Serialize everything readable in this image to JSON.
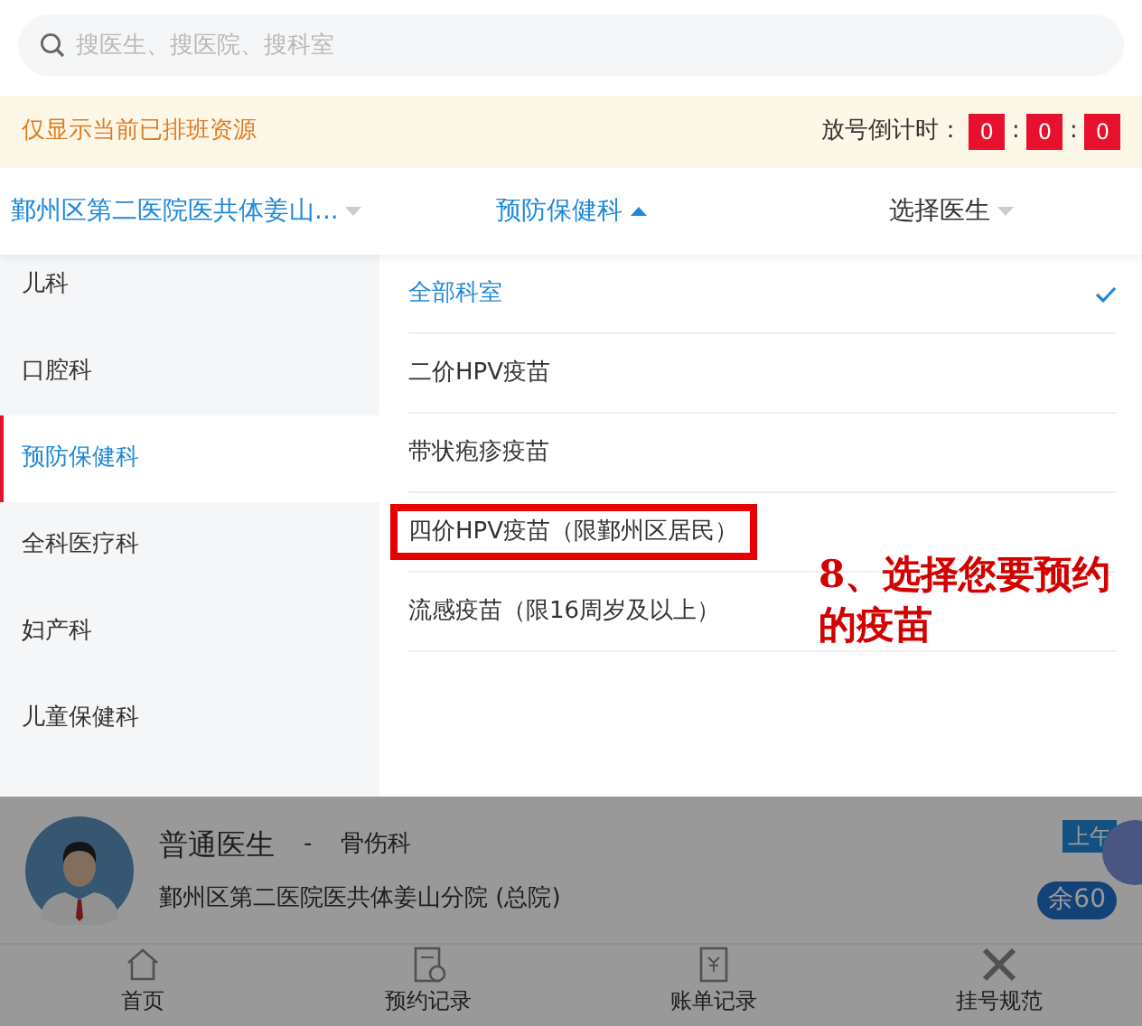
{
  "search": {
    "placeholder": "搜医生、搜医院、搜科室"
  },
  "notice": {
    "text": "仅显示当前已排班资源",
    "countdown_label": "放号倒计时：",
    "countdown": [
      "0",
      "0",
      "0"
    ],
    "separators": [
      ":",
      ":"
    ]
  },
  "filters": [
    {
      "label": "鄞州区第二医院医共体姜山...",
      "selected": true,
      "expanded": false
    },
    {
      "label": "预防保健科",
      "selected": true,
      "expanded": true
    },
    {
      "label": "选择医生",
      "selected": false,
      "expanded": false
    }
  ],
  "departments": [
    {
      "label": "儿科",
      "selected": false
    },
    {
      "label": "口腔科",
      "selected": false
    },
    {
      "label": "预防保健科",
      "selected": true
    },
    {
      "label": "全科医疗科",
      "selected": false
    },
    {
      "label": "妇产科",
      "selected": false
    },
    {
      "label": "儿童保健科",
      "selected": false
    }
  ],
  "sub_departments": [
    {
      "label": "全部科室",
      "selected": true,
      "highlighted": false
    },
    {
      "label": "二价HPV疫苗",
      "selected": false,
      "highlighted": false
    },
    {
      "label": "带状疱疹疫苗",
      "selected": false,
      "highlighted": false
    },
    {
      "label": "四价HPV疫苗（限鄞州区居民）",
      "selected": false,
      "highlighted": true
    },
    {
      "label": "流感疫苗（限16周岁及以上）",
      "selected": false,
      "highlighted": false
    }
  ],
  "annotation": {
    "text": "8、选择您要预约的疫苗"
  },
  "doctor_card": {
    "name": "普通医生",
    "separator": "-",
    "department": "骨伤科",
    "hospital": "鄞州区第二医院医共体姜山分院 (总院)",
    "session": "上午",
    "remaining": "余60"
  },
  "bottom_nav": [
    {
      "label": "首页",
      "kind": "home"
    },
    {
      "label": "预约记录",
      "kind": "records"
    },
    {
      "label": "账单记录",
      "kind": "bill"
    },
    {
      "label": "挂号规范",
      "kind": "rules"
    }
  ]
}
